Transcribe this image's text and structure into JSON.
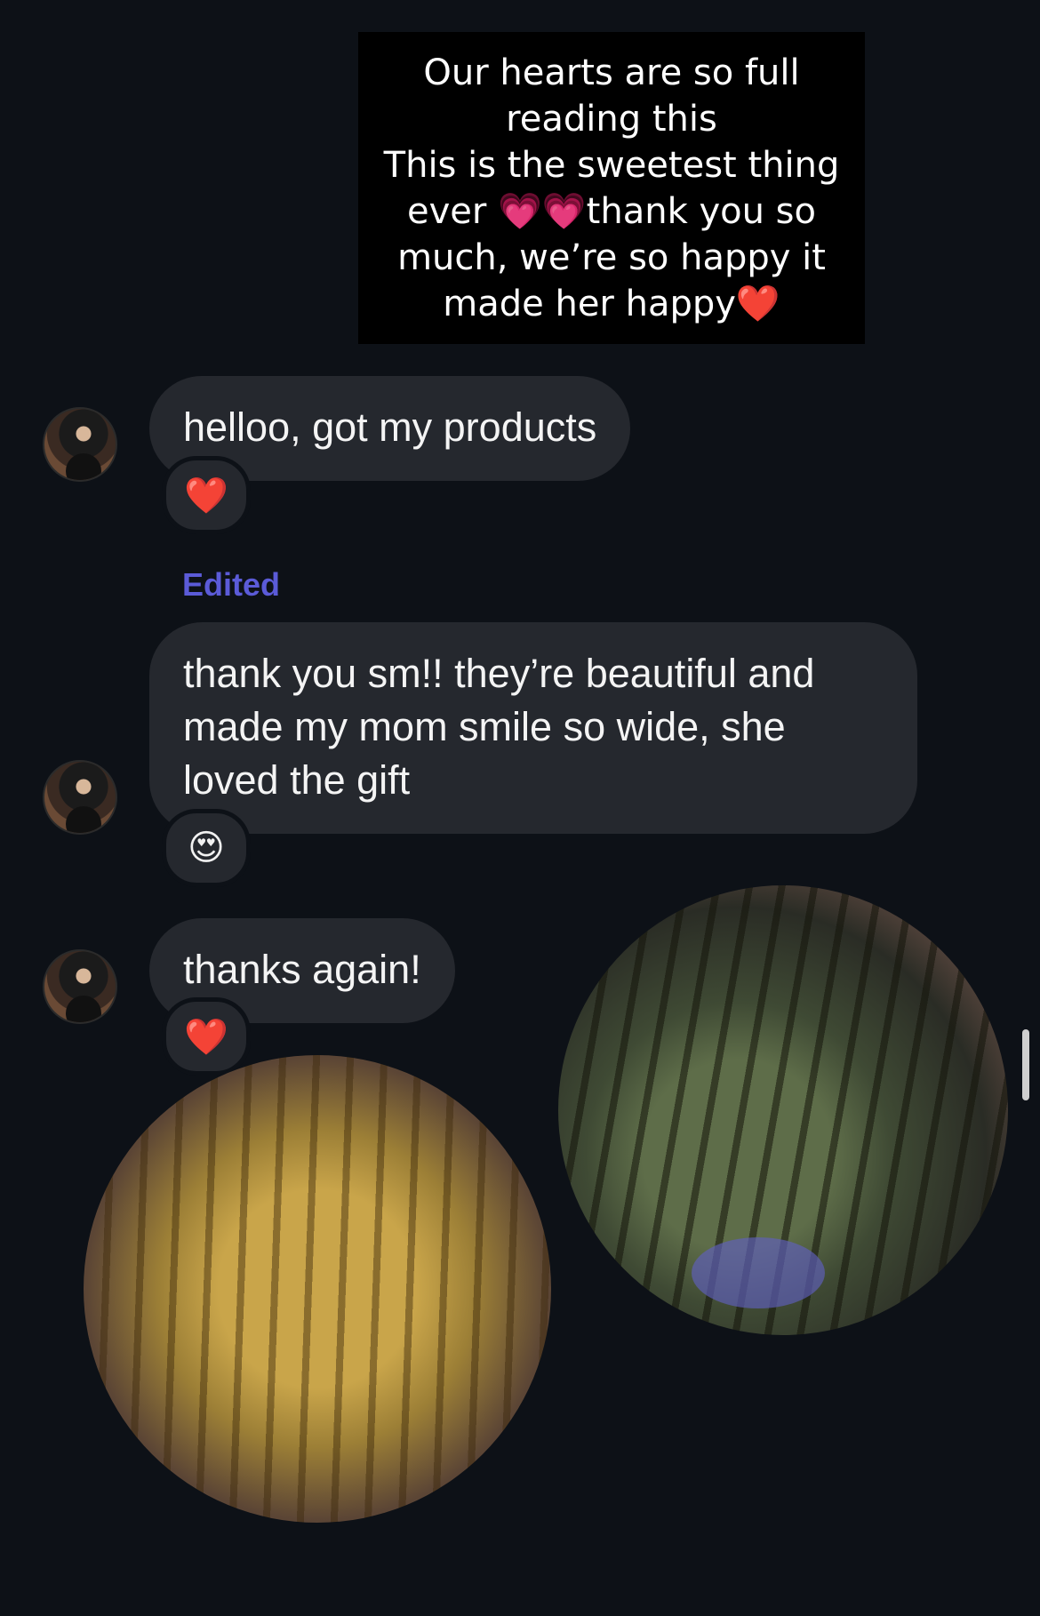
{
  "caption": {
    "lines": [
      "Our hearts are so full",
      "reading this",
      "This is the sweetest thing",
      "ever 💗💗thank you so",
      "much, we’re so happy it",
      "made her happy❤️"
    ]
  },
  "messages": [
    {
      "text": "helloo, got my products",
      "reaction": "❤️"
    },
    {
      "edited_label": "Edited",
      "text": "thank you sm!! they’re beautiful and made my mom smile so wide, she loved the gift",
      "reaction": "😍"
    },
    {
      "text": "thanks again!",
      "reaction": "❤️"
    }
  ],
  "icons": {
    "avatar": "profile-avatar",
    "reaction_heart": "red-heart",
    "reaction_smile": "heart-eyes-emoji"
  },
  "colors": {
    "background": "#0d1117",
    "bubble": "#25282e",
    "edited": "#5b5bd8"
  }
}
